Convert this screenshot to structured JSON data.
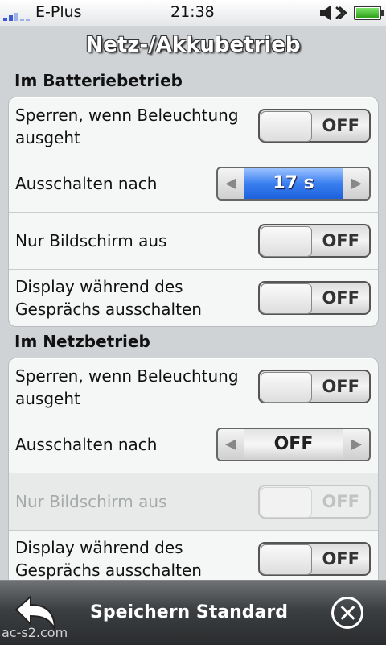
{
  "status_bar": {
    "carrier": "E-Plus",
    "time": "21:38"
  },
  "header": {
    "title": "Netz-/Akkubetrieb"
  },
  "sections": [
    {
      "title": "Im Batteriebetrieb",
      "rows": [
        {
          "label": "Sperren, wenn Beleuchtung ausgeht",
          "control": "toggle",
          "value": "OFF",
          "enabled": true
        },
        {
          "label": "Ausschalten nach",
          "control": "stepper",
          "value": "17 s",
          "enabled": true
        },
        {
          "label": "Nur Bildschirm aus",
          "control": "toggle",
          "value": "OFF",
          "enabled": true
        },
        {
          "label": "Display während des Gesprächs ausschalten",
          "control": "toggle",
          "value": "OFF",
          "enabled": true
        }
      ]
    },
    {
      "title": "Im Netzbetrieb",
      "rows": [
        {
          "label": "Sperren, wenn Beleuchtung ausgeht",
          "control": "toggle",
          "value": "OFF",
          "enabled": true
        },
        {
          "label": "Ausschalten nach",
          "control": "stepper",
          "value": "OFF",
          "enabled": true
        },
        {
          "label": "Nur Bildschirm aus",
          "control": "toggle",
          "value": "OFF",
          "enabled": false
        },
        {
          "label": "Display während des Gesprächs ausschalten",
          "control": "toggle",
          "value": "OFF",
          "enabled": true
        }
      ]
    }
  ],
  "toolbar": {
    "title": "Speichern Standard",
    "back_icon": "back-arrow-icon",
    "close_icon": "close-circle-icon"
  },
  "watermark": "ac-s2.com",
  "colors": {
    "accent_blue": "#3a7ef0",
    "battery_green": "#2fa11b"
  }
}
